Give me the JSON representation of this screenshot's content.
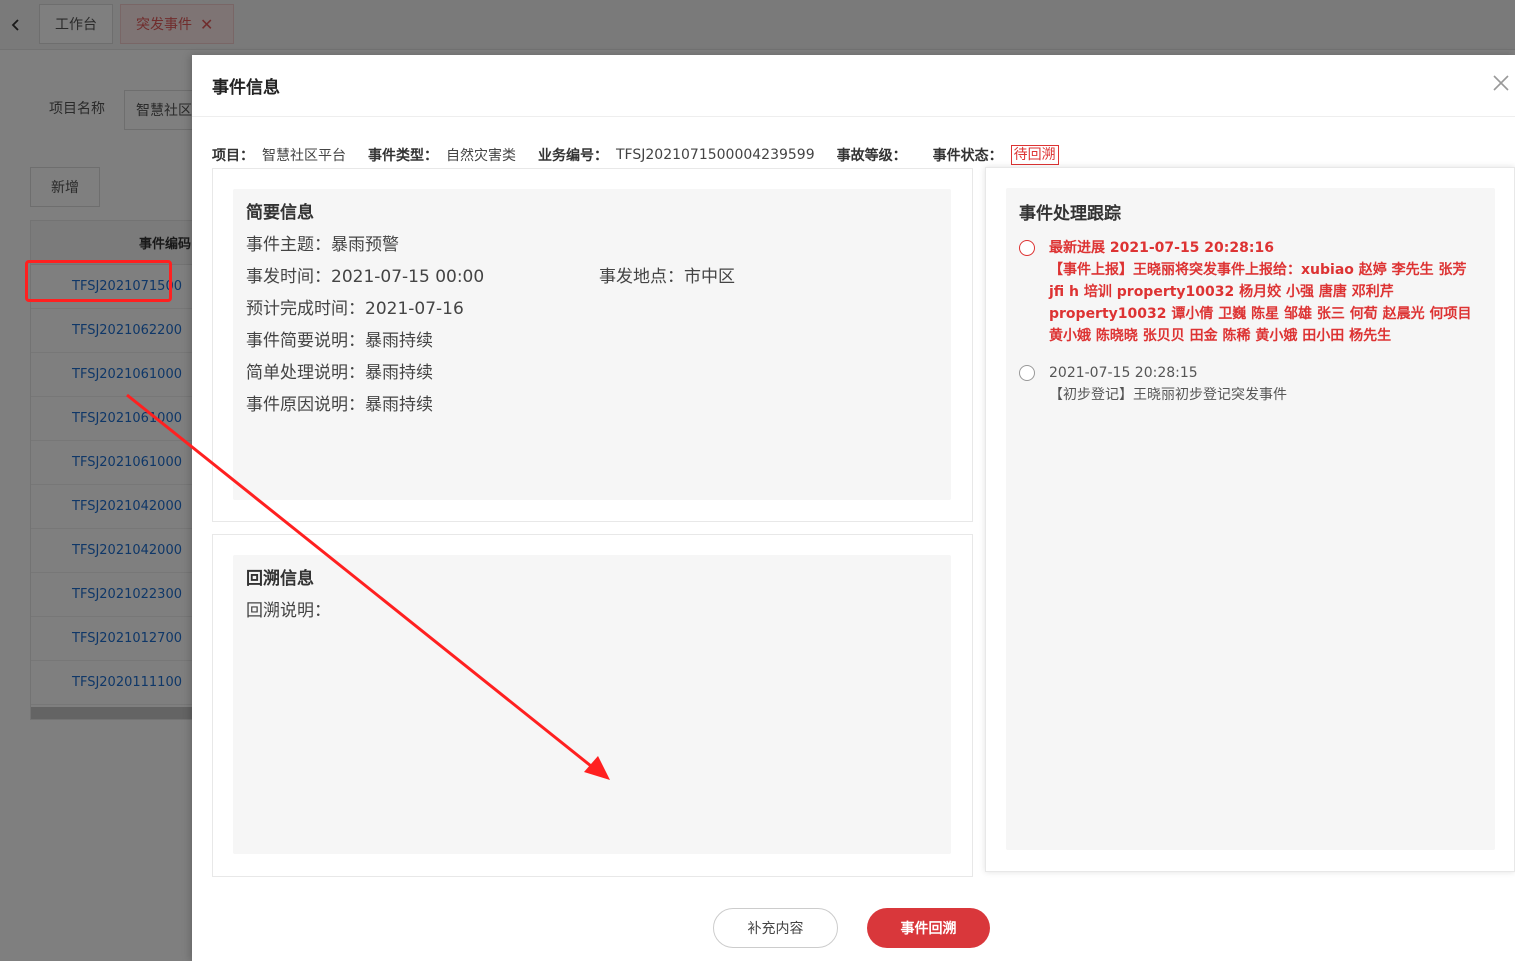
{
  "background": {
    "back_icon": "chevron-left-icon",
    "tabs": [
      {
        "label": "工作台"
      },
      {
        "label": "突发事件",
        "close": "✕"
      }
    ],
    "filter": {
      "label": "项目名称",
      "value": "智慧社区"
    },
    "add_button": "新增",
    "table": {
      "header": "事件编码",
      "rows": [
        "TFSJ2021071500",
        "TFSJ2021062200",
        "TFSJ2021061000",
        "TFSJ2021061000",
        "TFSJ2021061000",
        "TFSJ2021042000",
        "TFSJ2021042000",
        "TFSJ2021022300",
        "TFSJ2021012700",
        "TFSJ2020111100"
      ]
    }
  },
  "modal": {
    "title": "事件信息",
    "close_icon": "close-icon",
    "info": {
      "project_label": "项目：",
      "project": "智慧社区平台",
      "type_label": "事件类型：",
      "type": "自然灾害类",
      "code_label": "业务编号：",
      "code": "TFSJ2021071500004239599",
      "level_label": "事故等级：",
      "level": "",
      "status_label": "事件状态：",
      "status": "待回溯"
    },
    "summary": {
      "title": "简要信息",
      "subject_label": "事件主题：",
      "subject": "暴雨预警",
      "time_label": "事发时间：",
      "time": "2021-07-15 00:00",
      "place_label": "事发地点：",
      "place": "市中区",
      "eta_label": "预计完成时间：",
      "eta": "2021-07-16",
      "brief_label": "事件简要说明：",
      "brief": "暴雨持续",
      "handle_label": "简单处理说明：",
      "handle": "暴雨持续",
      "cause_label": "事件原因说明：",
      "cause": "暴雨持续"
    },
    "retro": {
      "title": "回溯信息",
      "desc_label": "回溯说明：",
      "desc": ""
    },
    "tracking": {
      "title": "事件处理跟踪",
      "items": [
        {
          "time": "最新进展 2021-07-15 20:28:16",
          "text": "【事件上报】王晓丽将突发事件上报给：xubiao 赵婷 李先生 张芳 jfi h 培训 property10032 杨月姣 小强 唐唐 邓利芹 property10032 谭小倩 卫巍 陈星 邹雄 张三 何荀 赵晨光 何项目 黄小娥 陈晓晓 张贝贝 田金 陈稀 黄小娥 田小田 杨先生"
        },
        {
          "time": "2021-07-15 20:28:15",
          "text": "【初步登记】王晓丽初步登记突发事件"
        }
      ]
    },
    "buttons": {
      "supplement": "补充内容",
      "retro": "事件回溯"
    }
  },
  "colors": {
    "accent_red": "#d9373b",
    "link_blue": "#1e6fd0",
    "annotation_red": "#ff2020"
  }
}
